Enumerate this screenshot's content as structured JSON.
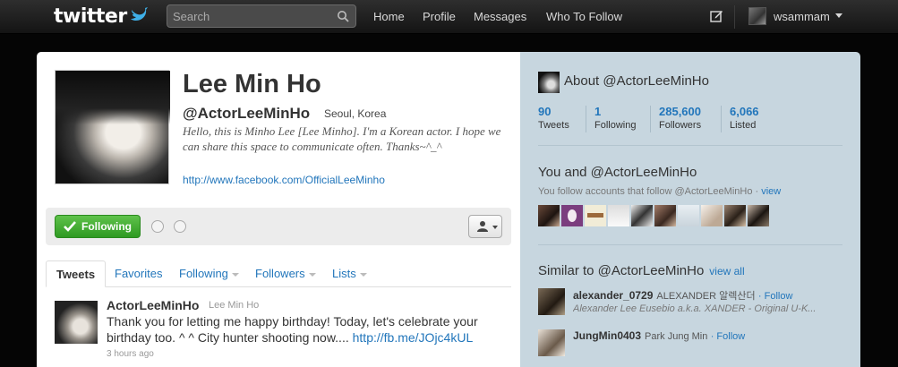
{
  "topbar": {
    "logo": "twitter",
    "search_placeholder": "Search",
    "nav": [
      "Home",
      "Profile",
      "Messages",
      "Who To Follow"
    ],
    "user": "wsammam"
  },
  "profile": {
    "full_name": "Lee Min Ho",
    "screen_name": "@ActorLeeMinHo",
    "location": "Seoul, Korea",
    "bio": "Hello, this is Minho Lee [Lee Minho]. I'm a Korean actor. I hope we can share this space to communicate often. Thanks~^_^",
    "url": "http://www.facebook.com/OfficialLeeMinho",
    "follow_label": "Following"
  },
  "tabs": [
    {
      "label": "Tweets"
    },
    {
      "label": "Favorites"
    },
    {
      "label": "Following"
    },
    {
      "label": "Followers"
    },
    {
      "label": "Lists"
    }
  ],
  "tweet": {
    "author": "ActorLeeMinHo",
    "full_name": "Lee Min Ho",
    "text": "Thank you for letting me happy birthday! Today, let's celebrate your birthday too. ^ ^ City hunter shooting now....",
    "link": "http://fb.me/JOjc4kUL",
    "time": "3 hours ago"
  },
  "sidebar": {
    "about_title": "About @ActorLeeMinHo",
    "stats": [
      {
        "value": "90",
        "label": "Tweets"
      },
      {
        "value": "1",
        "label": "Following"
      },
      {
        "value": "285,600",
        "label": "Followers"
      },
      {
        "value": "6,066",
        "label": "Listed"
      }
    ],
    "common_title": "You and @ActorLeeMinHo",
    "common_sub": "You follow accounts that follow @ActorLeeMinHo ·",
    "common_view": "view",
    "similar_title": "Similar to @ActorLeeMinHo",
    "similar_view_all": "view all",
    "similar": [
      {
        "name": "alexander_0729",
        "full": "ALEXANDER 알렉산더",
        "follow": "· Follow",
        "bio": "Alexander Lee Eusebio a.k.a. XANDER - Original U-K..."
      },
      {
        "name": "JungMin0403",
        "full": "Park Jung Min",
        "follow": "· Follow",
        "bio": ""
      }
    ]
  },
  "colors": {
    "link": "#2276bb",
    "sidebar_bg": "#c7d6df",
    "follow_green": "#2f9a22",
    "logo_bird": "#3fb0e8"
  }
}
